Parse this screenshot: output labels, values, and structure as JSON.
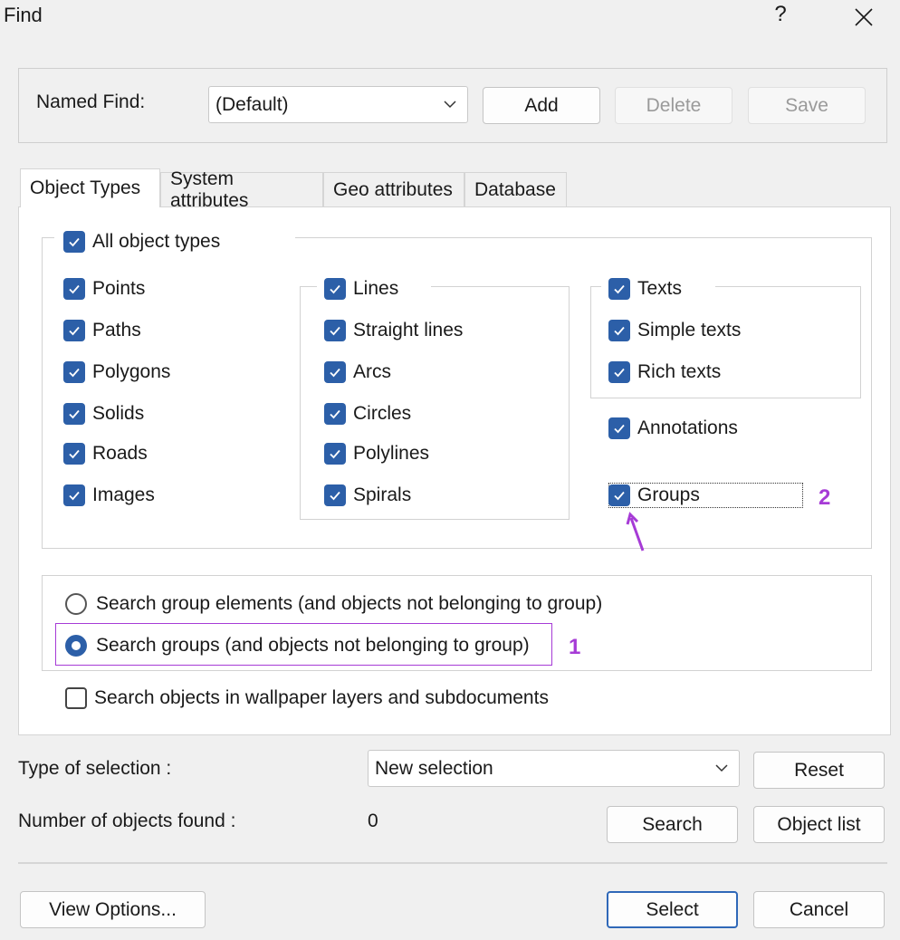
{
  "window": {
    "title": "Find",
    "help_glyph": "?",
    "close_glyph": "✕"
  },
  "named_find": {
    "label": "Named Find:",
    "combo_value": "(Default)",
    "add_label": "Add",
    "delete_label": "Delete",
    "save_label": "Save"
  },
  "tabs": [
    {
      "label": "Object Types"
    },
    {
      "label": "System attributes"
    },
    {
      "label": "Geo attributes"
    },
    {
      "label": "Database"
    }
  ],
  "object_types": {
    "all": "All object types",
    "col1": [
      "Points",
      "Paths",
      "Polygons",
      "Solids",
      "Roads",
      "Images"
    ],
    "lines": [
      "Lines",
      "Straight lines",
      "Arcs",
      "Circles",
      "Polylines",
      "Spirals"
    ],
    "texts": [
      "Texts",
      "Simple texts",
      "Rich texts"
    ],
    "annotations": "Annotations",
    "groups": "Groups"
  },
  "search_mode": {
    "elements": "Search group elements (and objects not belonging to group)",
    "groups": "Search groups (and objects not belonging to group)",
    "selected": "groups"
  },
  "wallpaper": "Search objects in wallpaper layers and subdocuments",
  "annotations_overlay": {
    "one": "1",
    "two": "2",
    "color": "#a63bd6"
  },
  "selection": {
    "label": "Type of selection :",
    "value": "New selection",
    "reset_label": "Reset"
  },
  "found": {
    "label": "Number of objects found :",
    "count": "0",
    "search_label": "Search",
    "object_list_label": "Object list"
  },
  "footer": {
    "view_options_label": "View Options...",
    "select_label": "Select",
    "cancel_label": "Cancel"
  },
  "colors": {
    "checkbox": "#2c5fa8",
    "default_button_border": "#2f68b8"
  }
}
